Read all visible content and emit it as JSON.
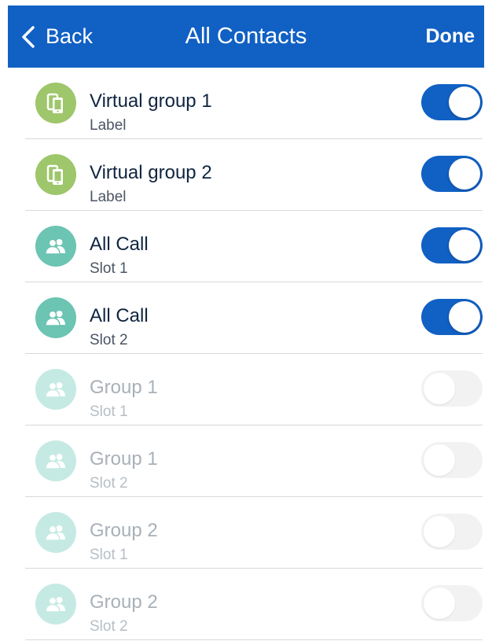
{
  "header": {
    "back_label": "Back",
    "title": "All Contacts",
    "done_label": "Done",
    "color": "#1160c4"
  },
  "rows": [
    {
      "title": "Virtual group 1",
      "subtitle": "Label",
      "icon": "phones-icon",
      "icon_color": "#9ec66b",
      "enabled": true
    },
    {
      "title": "Virtual group 2",
      "subtitle": "Label",
      "icon": "phones-icon",
      "icon_color": "#9ec66b",
      "enabled": true
    },
    {
      "title": "All Call",
      "subtitle": "Slot 1",
      "icon": "group-icon",
      "icon_color": "#6cc4b2",
      "enabled": true
    },
    {
      "title": "All Call",
      "subtitle": "Slot 2",
      "icon": "group-icon",
      "icon_color": "#6cc4b2",
      "enabled": true
    },
    {
      "title": "Group 1",
      "subtitle": "Slot 1",
      "icon": "group-icon",
      "icon_color": "#c5eae3",
      "enabled": false
    },
    {
      "title": "Group 1",
      "subtitle": "Slot 2",
      "icon": "group-icon",
      "icon_color": "#c5eae3",
      "enabled": false
    },
    {
      "title": "Group 2",
      "subtitle": "Slot 1",
      "icon": "group-icon",
      "icon_color": "#c5eae3",
      "enabled": false
    },
    {
      "title": "Group 2",
      "subtitle": "Slot 2",
      "icon": "group-icon",
      "icon_color": "#c5eae3",
      "enabled": false
    }
  ]
}
